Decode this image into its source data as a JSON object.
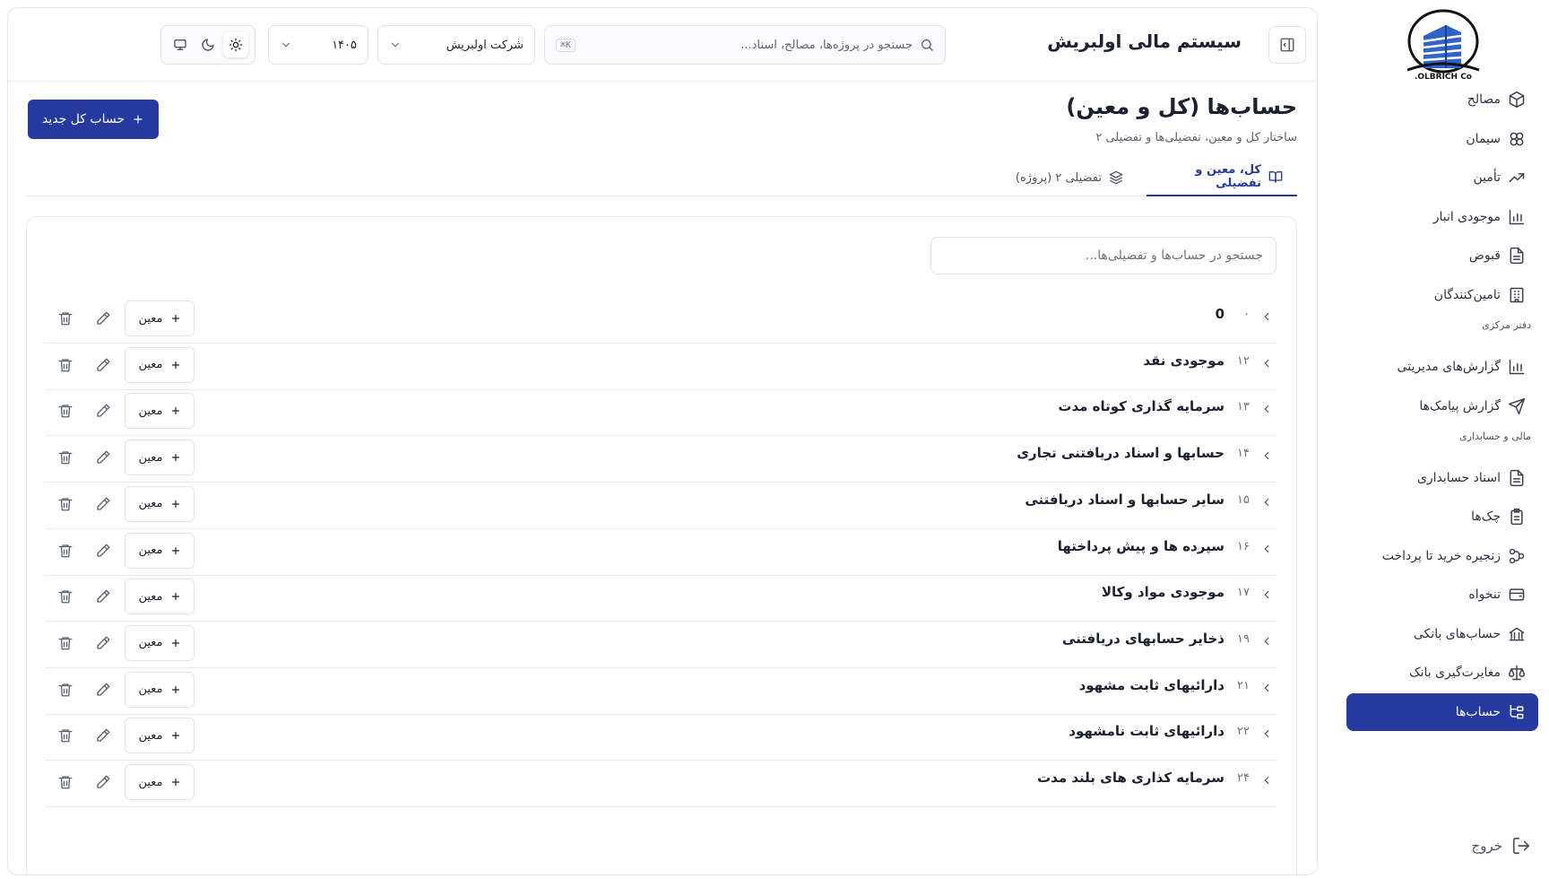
{
  "sidebar": {
    "logo_text": "OLBRICH Co.",
    "items_group1": [
      {
        "label": "مصالح",
        "icon": "cube-icon"
      },
      {
        "label": "سیمان",
        "icon": "boxes-icon"
      },
      {
        "label": "تأمین",
        "icon": "trending-up-icon"
      },
      {
        "label": "موجودی انبار",
        "icon": "bar-chart-icon"
      },
      {
        "label": "قبوض",
        "icon": "document-icon"
      },
      {
        "label": "تامین‌کنندگان",
        "icon": "building-icon"
      }
    ],
    "section_central": "دفتر مرکزی",
    "items_group2": [
      {
        "label": "گزارش‌های مدیریتی",
        "icon": "bar-chart-icon"
      },
      {
        "label": "گزارش پیامک‌ها",
        "icon": "send-icon"
      }
    ],
    "section_finance": "مالی و حسابداری",
    "items_group3": [
      {
        "label": "اسناد حسابداری",
        "icon": "document-icon"
      },
      {
        "label": "چک‌ها",
        "icon": "clipboard-icon"
      },
      {
        "label": "زنجیره خرید تا پرداخت",
        "icon": "workflow-icon"
      },
      {
        "label": "تنخواه",
        "icon": "wallet-icon"
      },
      {
        "label": "حساب‌های بانکی",
        "icon": "bank-icon"
      },
      {
        "label": "مغایرت‌گیری بانک",
        "icon": "scale-icon"
      },
      {
        "label": "حساب‌ها",
        "icon": "tree-icon"
      }
    ],
    "logout_label": "خروج"
  },
  "topbar": {
    "app_title": "سیستم مالی اولبریش",
    "search_placeholder": "جستجو در پروژه‌ها، مصالح، اسناد...",
    "shortcut": "K⌘",
    "company": "شرکت اولبریش",
    "year": "۱۴۰۵"
  },
  "page": {
    "title": "حساب‌ها (کل و معین)",
    "subtitle": "ساختار کل و معین، تفضیلی‌ها و تفضیلی ۲",
    "new_button": "حساب کل جدید",
    "tabs": [
      {
        "label": "کل، معین و تفضیلی"
      },
      {
        "label": "تفضیلی ۲ (پروژه)"
      }
    ],
    "search_placeholder": "جستجو در حساب‌ها و تفضیلی‌ها...",
    "add_label": "معین"
  },
  "accounts": [
    {
      "code": "۰",
      "name": "0"
    },
    {
      "code": "۱۲",
      "name": "موجودی نقد"
    },
    {
      "code": "۱۳",
      "name": "سرمایه گذاری کوتاه مدت"
    },
    {
      "code": "۱۴",
      "name": "حسابها و اسناد دریافتنی تجاری"
    },
    {
      "code": "۱۵",
      "name": "سایر حسابها و اسناد دریافتنی"
    },
    {
      "code": "۱۶",
      "name": "سپرده ها و پیش پرداختها"
    },
    {
      "code": "۱۷",
      "name": "موجودی مواد وکالا"
    },
    {
      "code": "۱۹",
      "name": "ذخایر حسابهای دریافتنی"
    },
    {
      "code": "۲۱",
      "name": "دارائیهای ثابت مشهود"
    },
    {
      "code": "۲۲",
      "name": "دارائیهای ثابت نامشهود"
    },
    {
      "code": "۲۴",
      "name": "سرمایه کذاری های بلند مدت"
    }
  ],
  "colors": {
    "accent": "#25399f",
    "border": "#e3e6ee"
  }
}
